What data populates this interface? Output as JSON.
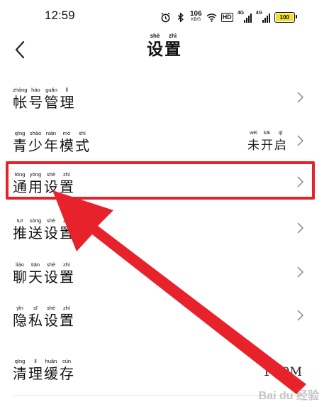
{
  "status_bar": {
    "time": "12:59",
    "speed_value": "106",
    "speed_unit": "KB/S",
    "hd_badge": "HD",
    "signal1_label": "4G",
    "signal2_label": "4G",
    "battery_percent": "100",
    "battery_color": "#f0df2d"
  },
  "header": {
    "title": [
      {
        "py": "shè",
        "hz": "设"
      },
      {
        "py": "zhì",
        "hz": "置"
      }
    ]
  },
  "items": [
    {
      "label": [
        {
          "py": "zhàng",
          "hz": "帐"
        },
        {
          "py": "hào",
          "hz": "号"
        },
        {
          "py": "guǎn",
          "hz": "管"
        },
        {
          "py": "lǐ",
          "hz": "理"
        }
      ]
    },
    {
      "label": [
        {
          "py": "qīng",
          "hz": "青"
        },
        {
          "py": "shào",
          "hz": "少"
        },
        {
          "py": "nián",
          "hz": "年"
        },
        {
          "py": "mó",
          "hz": "模"
        },
        {
          "py": "shì",
          "hz": "式"
        }
      ],
      "value": [
        {
          "py": "wèi",
          "hz": "未"
        },
        {
          "py": "kāi",
          "hz": "开"
        },
        {
          "py": "qǐ",
          "hz": "启"
        }
      ]
    },
    {
      "label": [
        {
          "py": "tōng",
          "hz": "通"
        },
        {
          "py": "yòng",
          "hz": "用"
        },
        {
          "py": "shè",
          "hz": "设"
        },
        {
          "py": "zhì",
          "hz": "置"
        }
      ]
    },
    {
      "label": [
        {
          "py": "tuī",
          "hz": "推"
        },
        {
          "py": "sòng",
          "hz": "送"
        },
        {
          "py": "shè",
          "hz": "设"
        },
        {
          "py": "zhì",
          "hz": "置"
        }
      ]
    },
    {
      "label": [
        {
          "py": "liáo",
          "hz": "聊"
        },
        {
          "py": "tiān",
          "hz": "天"
        },
        {
          "py": "shè",
          "hz": "设"
        },
        {
          "py": "zhì",
          "hz": "置"
        }
      ]
    },
    {
      "label": [
        {
          "py": "yǐn",
          "hz": "隐"
        },
        {
          "py": "sī",
          "hz": "私"
        },
        {
          "py": "shè",
          "hz": "设"
        },
        {
          "py": "zhì",
          "hz": "置"
        }
      ]
    },
    {
      "label": [
        {
          "py": "qīng",
          "hz": "清"
        },
        {
          "py": "lǐ",
          "hz": "理"
        },
        {
          "py": "huǎn",
          "hz": "缓"
        },
        {
          "py": "cún",
          "hz": "存"
        }
      ],
      "value_text": "16.0M"
    }
  ],
  "annotation": {
    "highlight_color": "#e8222a"
  },
  "watermark": "Bai du 经验"
}
